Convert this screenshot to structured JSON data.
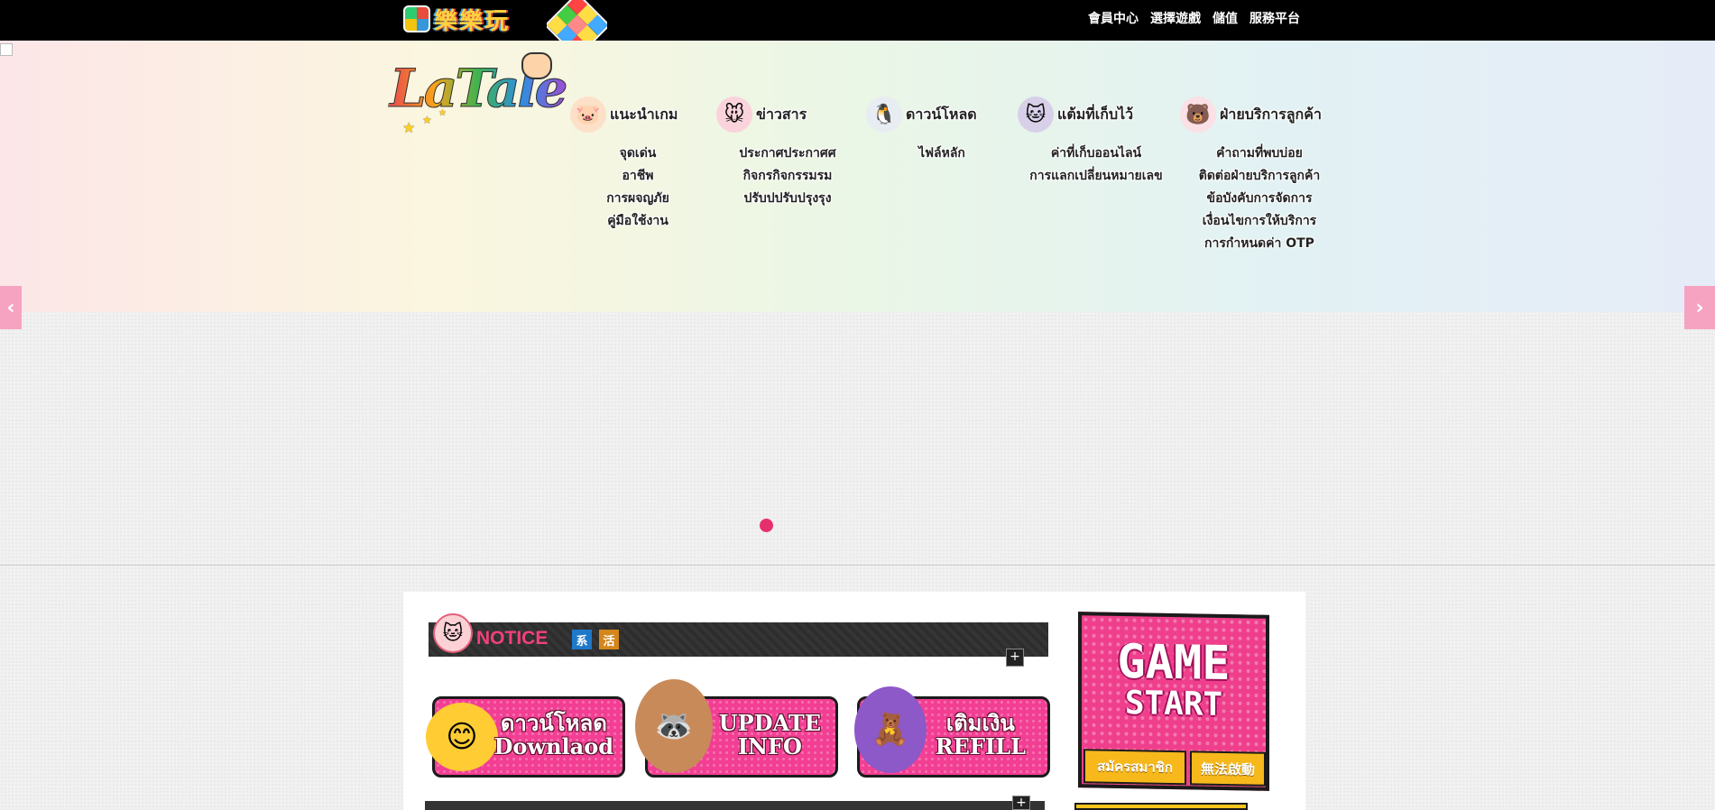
{
  "topbar": {
    "brand_text": "樂樂玩",
    "nav": [
      "會員中心",
      "選擇遊戲",
      "儲值",
      "服務平台"
    ]
  },
  "hero": {
    "logo_text": "LaTale",
    "menu": [
      {
        "title": "แนะนำเกม",
        "mascot": "pig-mascot-icon",
        "items": [
          "จุดเด่น",
          "อาชีพ",
          "การผจญภัย",
          "คู่มือใช้งาน"
        ]
      },
      {
        "title": "ข่าวสาร",
        "mascot": "mouse-mascot-icon",
        "items": [
          "ประกาศประกาศศ",
          "กิจกรกิจกรรมรม",
          "ปรับปปรับปรุงรุง"
        ]
      },
      {
        "title": "ดาวน์โหลด",
        "mascot": "penguin-mascot-icon",
        "items": [
          "ไฟล์หลัก"
        ]
      },
      {
        "title": "แต้มที่เก็บไว้",
        "mascot": "cat-mascot-icon",
        "items": [
          "ค่าที่เก็บออนไลน์",
          "การแลกเปลี่ยนหมายเลข"
        ]
      },
      {
        "title": "ฝ่ายบริการลูกค้า",
        "mascot": "bear-mascot-icon",
        "items": [
          "คำถามที่พบบ่อย",
          "ติดต่อฝ่ายบริการลูกค้า",
          "ข้อบังคับการจัดการ",
          "เงื่อนไขการให้บริการ",
          "การกำหนดค่า OTP"
        ]
      }
    ],
    "prev_arrow": "‹",
    "next_arrow": "›"
  },
  "notice": {
    "title": "NOTICE",
    "tabs": [
      {
        "label": "系",
        "color": "#1f78c8"
      },
      {
        "label": "活",
        "color": "#d4861c"
      }
    ],
    "more": "+"
  },
  "buttons": {
    "download": {
      "line1": "ดาวน์โหลด",
      "line2": "Downlaod"
    },
    "update": {
      "line1": "UPDATE",
      "line2": "INFO"
    },
    "refill": {
      "line1": "เติมเงิน",
      "line2": "REFILL"
    }
  },
  "game_start": {
    "line1": "GAME",
    "line2": "START",
    "register": "สมัครสมาชิก",
    "cannot_start": "無法啟動"
  },
  "colors": {
    "accent_pink": "#f23e93",
    "dot_pink": "#e6306e",
    "gold": "#f7b81c"
  }
}
